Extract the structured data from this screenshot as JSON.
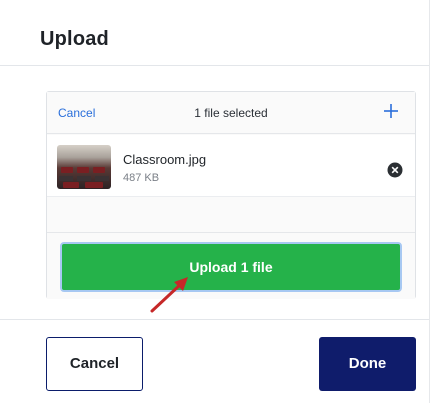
{
  "dialog": {
    "title": "Upload"
  },
  "uploader": {
    "cancel_label": "Cancel",
    "status_text": "1 file selected",
    "add_icon": "plus-icon",
    "files": [
      {
        "name": "Classroom.jpg",
        "size": "487 KB",
        "thumbnail": "classroom-photo",
        "remove_icon": "remove-circle-icon"
      }
    ],
    "upload_button_label": "Upload 1 file"
  },
  "footer": {
    "cancel_label": "Cancel",
    "done_label": "Done"
  },
  "colors": {
    "link": "#2a6fdb",
    "upload_button": "#25b24a",
    "upload_button_focus_ring": "#a7c8f2",
    "done_button": "#0f1c6b",
    "annotation_arrow": "#c62828"
  }
}
